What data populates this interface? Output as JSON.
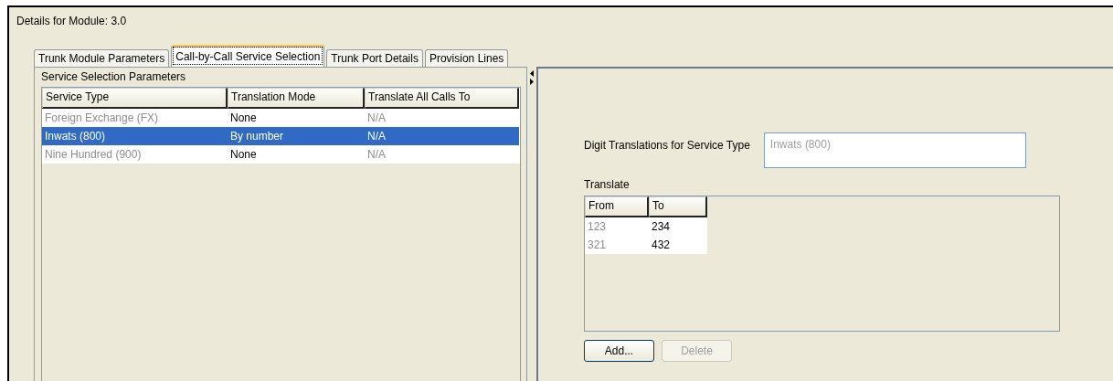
{
  "title": "Details for Module: 3.0",
  "tabs": [
    {
      "label": "Trunk Module Parameters",
      "selected": false
    },
    {
      "label": "Call-by-Call Service Selection",
      "selected": true
    },
    {
      "label": "Trunk Port Details",
      "selected": false
    },
    {
      "label": "Provision Lines",
      "selected": false
    }
  ],
  "service_selection": {
    "title": "Service Selection Parameters",
    "columns": [
      {
        "label": "Service Type",
        "greyed": true
      },
      {
        "label": "Translation Mode",
        "greyed": false
      },
      {
        "label": "Translate All Calls To",
        "greyed": true
      }
    ],
    "rows": [
      {
        "cells": [
          "Foreign Exchange (FX)",
          "None",
          "N/A"
        ],
        "selected": false
      },
      {
        "cells": [
          "Inwats (800)",
          "By number",
          "N/A"
        ],
        "selected": true
      },
      {
        "cells": [
          "Nine Hundred (900)",
          "None",
          "N/A"
        ],
        "selected": false
      }
    ]
  },
  "digit_translations": {
    "label": "Digit Translations for Service Type",
    "value": "Inwats (800)",
    "disabled": true,
    "translate_label": "Translate",
    "columns": [
      {
        "label": "From",
        "greyed": true
      },
      {
        "label": "To",
        "greyed": false
      }
    ],
    "rows": [
      {
        "cells": [
          "123",
          "234"
        ]
      },
      {
        "cells": [
          "321",
          "432"
        ]
      }
    ],
    "buttons": [
      {
        "label": "Add...",
        "disabled": false
      },
      {
        "label": "Delete",
        "disabled": true
      }
    ]
  }
}
